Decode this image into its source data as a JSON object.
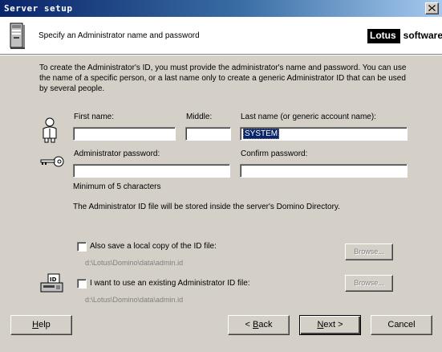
{
  "window": {
    "title": "Server setup"
  },
  "header": {
    "title": "Specify an Administrator name and password",
    "logo_lotus": "Lotus",
    "logo_software": "software"
  },
  "intro": "To create the Administrator's ID, you must provide the administrator's name and password. You can use the name of a specific person, or a last name only to create a generic Administrator ID that can be used by several people.",
  "name_fields": {
    "first_label": "First name:",
    "first_value": "",
    "middle_label": "Middle:",
    "middle_value": "",
    "last_label": "Last name (or generic account name):",
    "last_value": "SYSTEM"
  },
  "password_fields": {
    "password_label": "Administrator password:",
    "password_value": "",
    "confirm_label": "Confirm password:",
    "confirm_value": "",
    "min_note": "Minimum of 5 characters"
  },
  "storage_note": "The Administrator ID file will be stored inside the server's Domino Directory.",
  "options": {
    "save_local": {
      "label": "Also save a local copy of the ID file:",
      "checked": false,
      "path": "d:\\Lotus\\Domino\\data\\admin.id",
      "browse": "Browse..."
    },
    "use_existing": {
      "label": "I want to use an existing Administrator ID file:",
      "checked": false,
      "path": "d:\\Lotus\\Domino\\data\\admin.id",
      "browse": "Browse..."
    }
  },
  "buttons": {
    "help": {
      "mnemonic": "H",
      "rest": "elp"
    },
    "back": {
      "prefix": "< ",
      "mnemonic": "B",
      "rest": "ack"
    },
    "next": {
      "mnemonic": "N",
      "rest": "ext >"
    },
    "cancel": "Cancel"
  },
  "colors": {
    "title_gradient_start": "#0a246a",
    "title_gradient_end": "#a6caf0",
    "dialog_bg": "#d4d0c8",
    "selection": "#0a246a"
  },
  "icons": [
    "close-icon",
    "server-icon",
    "person-icon",
    "key-icon",
    "id-card-icon"
  ]
}
